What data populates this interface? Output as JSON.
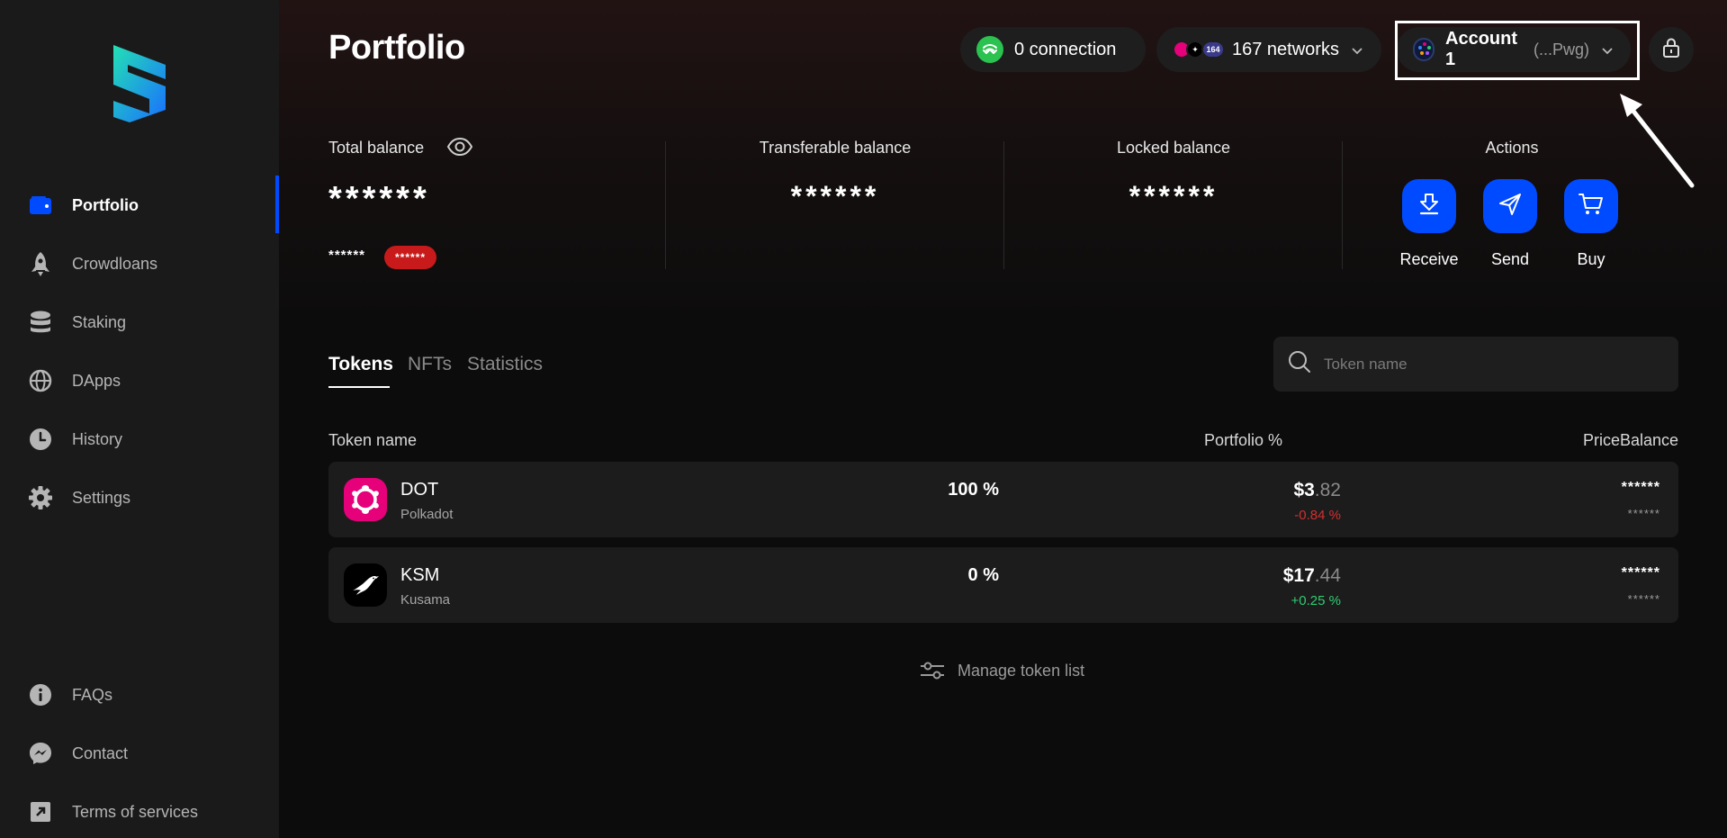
{
  "sidebar": {
    "items": [
      {
        "label": "Portfolio",
        "icon": "wallet-icon"
      },
      {
        "label": "Crowdloans",
        "icon": "rocket-icon"
      },
      {
        "label": "Staking",
        "icon": "database-icon"
      },
      {
        "label": "DApps",
        "icon": "globe-icon"
      },
      {
        "label": "History",
        "icon": "clock-icon"
      },
      {
        "label": "Settings",
        "icon": "gear-icon"
      }
    ],
    "bottom_items": [
      {
        "label": "FAQs",
        "icon": "info-icon"
      },
      {
        "label": "Contact",
        "icon": "messenger-icon"
      },
      {
        "label": "Terms of services",
        "icon": "external-link-icon"
      }
    ]
  },
  "header": {
    "title": "Portfolio",
    "connection_label": "0 connection",
    "networks_label": "167 networks",
    "networks_badge": "164",
    "account_name": "Account 1",
    "account_address": "(...Pwg)"
  },
  "balances": {
    "total_label": "Total balance",
    "total_value": "******",
    "total_sub_value": "******",
    "total_badge": "******",
    "transferable_label": "Transferable balance",
    "transferable_value": "******",
    "locked_label": "Locked balance",
    "locked_value": "******",
    "actions_label": "Actions",
    "actions": [
      {
        "label": "Receive"
      },
      {
        "label": "Send"
      },
      {
        "label": "Buy"
      }
    ]
  },
  "tabs": [
    {
      "label": "Tokens"
    },
    {
      "label": "NFTs"
    },
    {
      "label": "Statistics"
    }
  ],
  "search": {
    "placeholder": "Token name"
  },
  "table": {
    "headers": {
      "token_name": "Token name",
      "portfolio": "Portfolio %",
      "price": "Price",
      "balance": "Balance"
    },
    "rows": [
      {
        "symbol": "DOT",
        "name": "Polkadot",
        "portfolio": "100 %",
        "price_int": "$3",
        "price_dec": ".82",
        "change": "-0.84 %",
        "balance": "******",
        "balance_sub": "******",
        "change_color": "#d32f2f"
      },
      {
        "symbol": "KSM",
        "name": "Kusama",
        "portfolio": "0 %",
        "price_int": "$17",
        "price_dec": ".44",
        "change": "+0.25 %",
        "balance": "******",
        "balance_sub": "******",
        "change_color": "#2ecc71"
      }
    ]
  },
  "manage_label": "Manage token list",
  "colors": {
    "accent": "#004bff",
    "connection": "#2bc24f",
    "negative": "#d32f2f",
    "positive": "#2ecc71",
    "polkadot": "#e6007a"
  }
}
